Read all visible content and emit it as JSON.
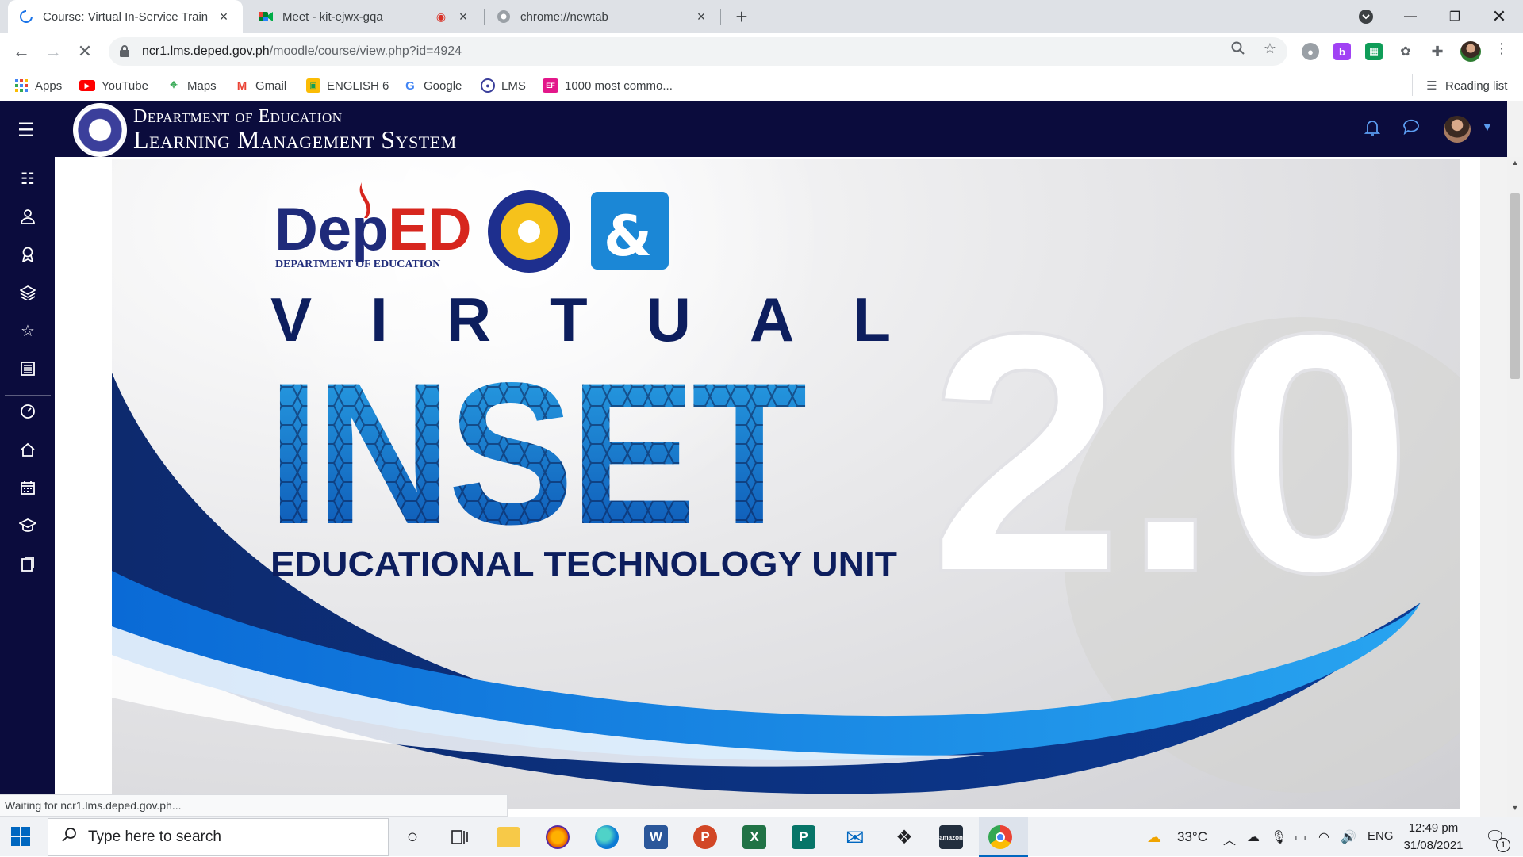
{
  "browser": {
    "tabs": [
      {
        "title": "Course: Virtual In-Service Training",
        "active": true,
        "icon": "loading-spinner-icon"
      },
      {
        "title": "Meet - kit-ejwx-gqa",
        "active": false,
        "icon": "google-meet-icon",
        "recording": true
      },
      {
        "title": "chrome://newtab",
        "active": false,
        "icon": "chrome-icon"
      }
    ],
    "new_tab_label": "+",
    "url_host": "ncr1.lms.deped.gov.ph",
    "url_path": "/moodle/course/view.php?id=4924",
    "status_text": "Waiting for ncr1.lms.deped.gov.ph...",
    "bookmarks": [
      {
        "label": "Apps",
        "icon": "apps-grid-icon"
      },
      {
        "label": "YouTube",
        "icon": "youtube-icon"
      },
      {
        "label": "Maps",
        "icon": "maps-icon"
      },
      {
        "label": "Gmail",
        "icon": "gmail-icon"
      },
      {
        "label": "ENGLISH 6",
        "icon": "classroom-icon"
      },
      {
        "label": "Google",
        "icon": "google-icon"
      },
      {
        "label": "LMS",
        "icon": "lms-icon"
      },
      {
        "label": "1000 most commo...",
        "icon": "ef-icon"
      }
    ],
    "reading_list_label": "Reading list"
  },
  "lms": {
    "org_line": "Department of Education",
    "system_line": "Learning Management System"
  },
  "banner": {
    "logo_text": "DepED",
    "logo_subtext": "DEPARTMENT OF EDUCATION",
    "word_virtual": "VIRTUAL",
    "word_inset": "INSET",
    "version": "2.0",
    "unit": "EDUCATIONAL TECHNOLOGY UNIT"
  },
  "taskbar": {
    "search_placeholder": "Type here to search",
    "weather": "33°C",
    "language": "ENG",
    "time": "12:49 pm",
    "date": "31/08/2021",
    "notification_count": "1"
  },
  "colors": {
    "lms_navy": "#0b0c3d",
    "banner_blue": "#1565c0",
    "banner_dark": "#0d2a6e",
    "chrome_tabstrip": "#dee1e6"
  }
}
